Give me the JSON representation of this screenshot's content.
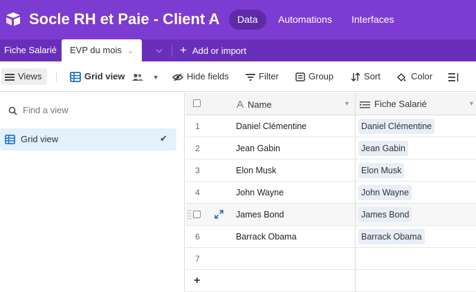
{
  "base": {
    "title": "Socle RH et Paie - Client A",
    "logo_icon": "airtable-logo-icon",
    "accent_color": "#7c3bd1"
  },
  "top_tabs": [
    {
      "label": "Data",
      "active": true
    },
    {
      "label": "Automations",
      "active": false
    },
    {
      "label": "Interfaces",
      "active": false
    }
  ],
  "table_tabs": [
    {
      "label": "Fiche Salarié",
      "active": false
    },
    {
      "label": "EVP du mois",
      "active": true
    }
  ],
  "add_import_label": "Add or import",
  "toolbar": {
    "views_label": "Views",
    "grid_view_label": "Grid view",
    "hide_fields_label": "Hide fields",
    "filter_label": "Filter",
    "group_label": "Group",
    "sort_label": "Sort",
    "color_label": "Color"
  },
  "sidebar": {
    "find_placeholder": "Find a view",
    "views": [
      {
        "label": "Grid view",
        "selected": true
      }
    ]
  },
  "grid": {
    "columns": [
      {
        "label": "Name",
        "type_icon": "text-a-icon"
      },
      {
        "label": "Fiche Salarié",
        "type_icon": "linked-record-icon"
      }
    ],
    "rows": [
      {
        "num": "1",
        "name": "Daniel Clémentine",
        "link": "Daniel Clémentine"
      },
      {
        "num": "2",
        "name": "Jean Gabin",
        "link": "Jean Gabin"
      },
      {
        "num": "3",
        "name": "Elon Musk",
        "link": "Elon Musk"
      },
      {
        "num": "4",
        "name": "John Wayne",
        "link": "John Wayne"
      },
      {
        "num": "",
        "name": "James Bond",
        "link": "James Bond"
      },
      {
        "num": "6",
        "name": "Barrack Obama",
        "link": "Barrack Obama"
      },
      {
        "num": "7",
        "name": "",
        "link": ""
      }
    ],
    "add_row_label": "+"
  }
}
